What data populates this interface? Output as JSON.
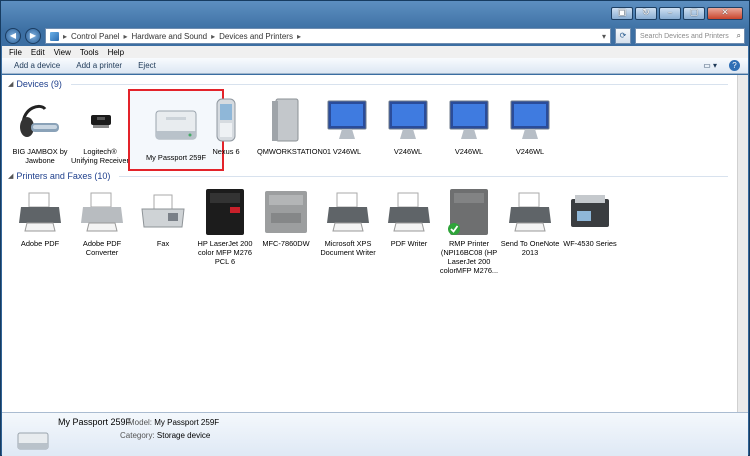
{
  "window": {
    "caption_buttons": [
      "▣",
      "↻",
      "–",
      "▢",
      "✕"
    ]
  },
  "address": {
    "crumbs": [
      "Control Panel",
      "Hardware and Sound",
      "Devices and Printers"
    ],
    "placeholder": "Search Devices and Printers"
  },
  "menu": [
    "File",
    "Edit",
    "View",
    "Tools",
    "Help"
  ],
  "toolbar": {
    "add_device": "Add a device",
    "add_printer": "Add a printer",
    "eject": "Eject"
  },
  "devices": {
    "header": "Devices (9)",
    "items": [
      {
        "label": "BIG JAMBOX by Jawbone",
        "icon": "headset-icon"
      },
      {
        "label": "Logitech® Unifying Receiver",
        "icon": "usb-receiver-icon"
      },
      {
        "label": "My Passport 259F",
        "icon": "external-drive-icon",
        "selected": true
      },
      {
        "label": "Nexus 6",
        "icon": "phone-icon"
      },
      {
        "label": "QMWORKSTATION01",
        "icon": "computer-tower-icon"
      },
      {
        "label": "V246WL",
        "icon": "monitor-icon"
      },
      {
        "label": "V246WL",
        "icon": "monitor-icon"
      },
      {
        "label": "V246WL",
        "icon": "monitor-icon"
      },
      {
        "label": "V246WL",
        "icon": "monitor-icon"
      }
    ]
  },
  "printers": {
    "header": "Printers and Faxes (10)",
    "items": [
      {
        "label": "Adobe PDF",
        "icon": "printer-icon"
      },
      {
        "label": "Adobe PDF Converter",
        "icon": "printer-icon"
      },
      {
        "label": "Fax",
        "icon": "fax-icon"
      },
      {
        "label": "HP LaserJet 200 color MFP M276 PCL 6",
        "icon": "mfp-black-icon"
      },
      {
        "label": "MFC-7860DW",
        "icon": "mfp-gray-icon"
      },
      {
        "label": "Microsoft XPS Document Writer",
        "icon": "printer-icon"
      },
      {
        "label": "PDF Writer",
        "icon": "printer-icon"
      },
      {
        "label": "RMP Printer (NPI16BC08 (HP LaserJet 200 colorMFP M276...",
        "icon": "mfp-default-icon"
      },
      {
        "label": "Send To OneNote 2013",
        "icon": "printer-icon"
      },
      {
        "label": "WF-4530 Series",
        "icon": "inkjet-icon"
      }
    ]
  },
  "details": {
    "name": "My Passport 259F",
    "model_label": "Model:",
    "model_value": "My Passport 259F",
    "category_label": "Category:",
    "category_value": "Storage device"
  }
}
